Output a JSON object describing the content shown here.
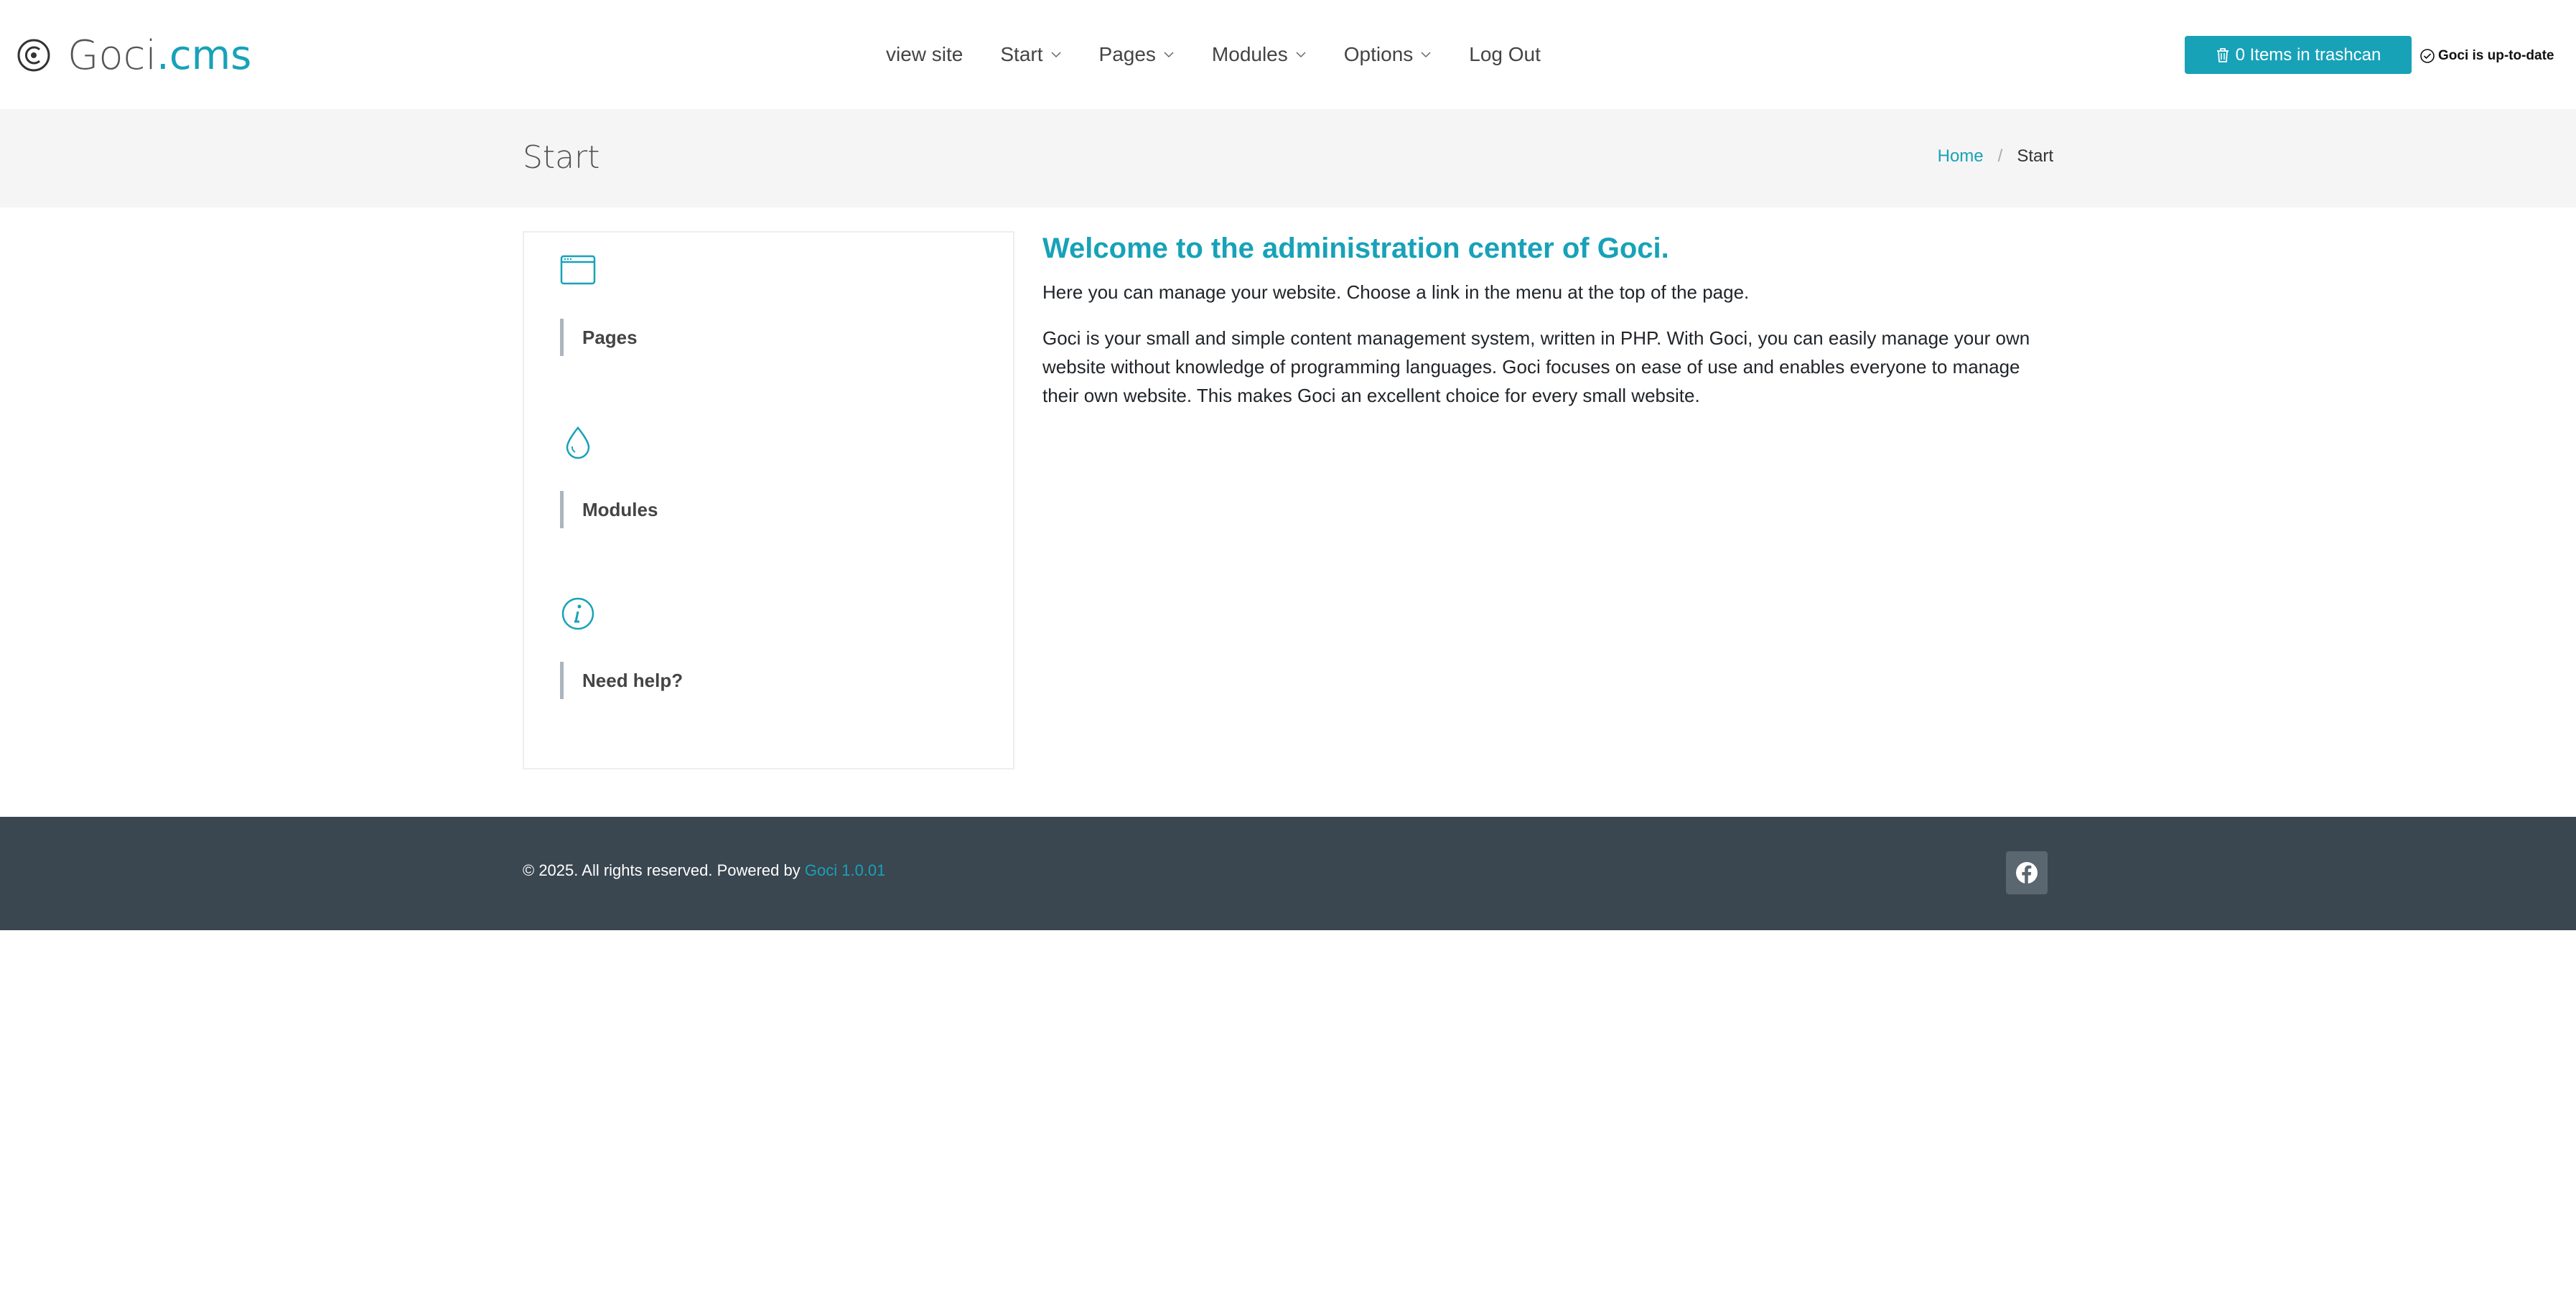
{
  "header": {
    "logo": {
      "icon": "goci-logo-icon",
      "text_main": "Goci",
      "text_accent": ".cms"
    },
    "nav": [
      {
        "label": "view site",
        "has_dropdown": false
      },
      {
        "label": "Start",
        "has_dropdown": true
      },
      {
        "label": "Pages",
        "has_dropdown": true
      },
      {
        "label": "Modules",
        "has_dropdown": true
      },
      {
        "label": "Options",
        "has_dropdown": true
      },
      {
        "label": "Log Out",
        "has_dropdown": false
      }
    ],
    "trash_button": {
      "icon": "trash-icon",
      "label": "0 Items in trashcan"
    },
    "status": {
      "icon": "check-circle-icon",
      "label": "Goci is up-to-date"
    }
  },
  "title_band": {
    "title": "Start",
    "breadcrumb": {
      "home": "Home",
      "separator": "/",
      "current": "Start"
    }
  },
  "sidebar": {
    "items": [
      {
        "icon": "browser-window-icon",
        "label": "Pages"
      },
      {
        "icon": "droplet-icon",
        "label": "Modules"
      },
      {
        "icon": "info-circle-icon",
        "label": "Need help?"
      }
    ]
  },
  "main": {
    "heading": "Welcome to the administration center of Goci.",
    "intro": "Here you can manage your website. Choose a link in the menu at the top of the page.",
    "description": "Goci is your small and simple content management system, written in PHP. With Goci, you can easily manage your own website without knowledge of programming languages. Goci focuses on ease of use and enables everyone to manage their own website. This makes Goci an excellent choice for every small website."
  },
  "footer": {
    "copyright": "© 2025. All rights reserved. Powered by",
    "powered_link": "Goci 1.0.01",
    "social_icon": "facebook-icon"
  },
  "colors": {
    "accent": "#17a2b8",
    "footer_bg": "#3a4650",
    "band_bg": "#f5f5f5"
  }
}
